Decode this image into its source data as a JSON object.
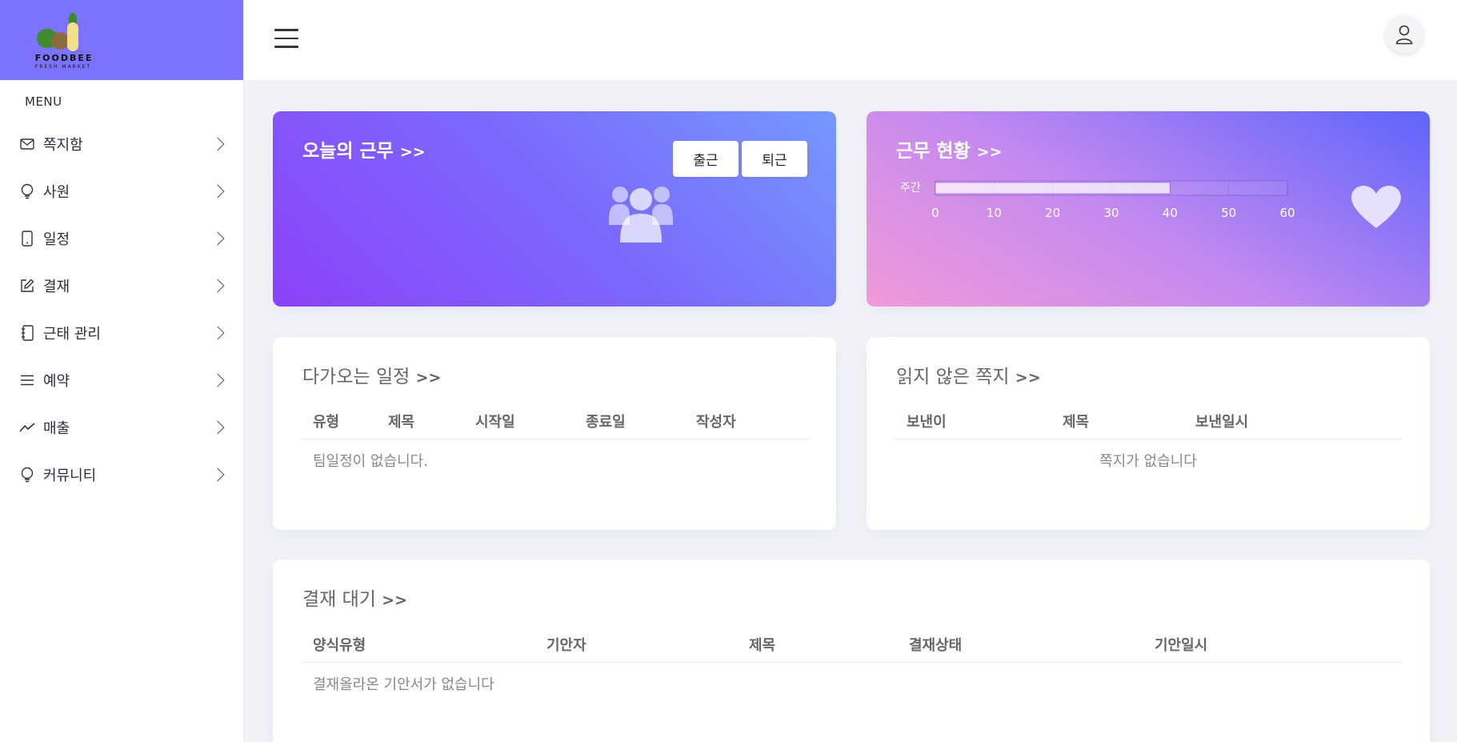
{
  "logo": {
    "brand": "FOODBEE",
    "sub": "FRESH MARKET"
  },
  "sidebar": {
    "menu_title": "MENU",
    "items": [
      {
        "label": "쪽지함",
        "icon": "mail-icon"
      },
      {
        "label": "사원",
        "icon": "lightbulb-icon"
      },
      {
        "label": "일정",
        "icon": "tablet-icon"
      },
      {
        "label": "결재",
        "icon": "edit-icon"
      },
      {
        "label": "근태 관리",
        "icon": "notebook-icon"
      },
      {
        "label": "예약",
        "icon": "list-icon"
      },
      {
        "label": "매출",
        "icon": "trend-icon"
      },
      {
        "label": "커뮤니티",
        "icon": "lightbulb-icon"
      }
    ]
  },
  "work_today": {
    "title": "오늘의 근무",
    "arrow": ">>",
    "clock_in": "출근",
    "clock_out": "퇴근"
  },
  "work_status": {
    "title": "근무 현황",
    "arrow": ">>",
    "chart_data": {
      "type": "bar",
      "orientation": "horizontal",
      "categories": [
        "주간"
      ],
      "values": [
        40
      ],
      "xlim": [
        0,
        60
      ],
      "ticks": [
        "0",
        "10",
        "20",
        "30",
        "40",
        "50",
        "60"
      ]
    }
  },
  "schedule": {
    "title": "다가오는 일정",
    "arrow": ">>",
    "columns": [
      "유형",
      "제목",
      "시작일",
      "종료일",
      "작성자"
    ],
    "empty": "팀일정이 없습니다."
  },
  "messages": {
    "title": "읽지 않은 쪽지",
    "arrow": ">>",
    "columns": [
      "보낸이",
      "제목",
      "보낸일시"
    ],
    "empty": "쪽지가 없습니다"
  },
  "approval": {
    "title": "결재 대기",
    "arrow": ">>",
    "columns": [
      "양식유형",
      "기안자",
      "제목",
      "결재상태",
      "기안일시"
    ],
    "empty": "결재올라온 기안서가 없습니다"
  },
  "colors": {
    "sidebar_brand": "#7b73fd",
    "work_card_start": "#8b42f8",
    "work_card_end": "#7598fd",
    "status_card_start": "#f09ad8",
    "status_card_end": "#5e64fb"
  }
}
